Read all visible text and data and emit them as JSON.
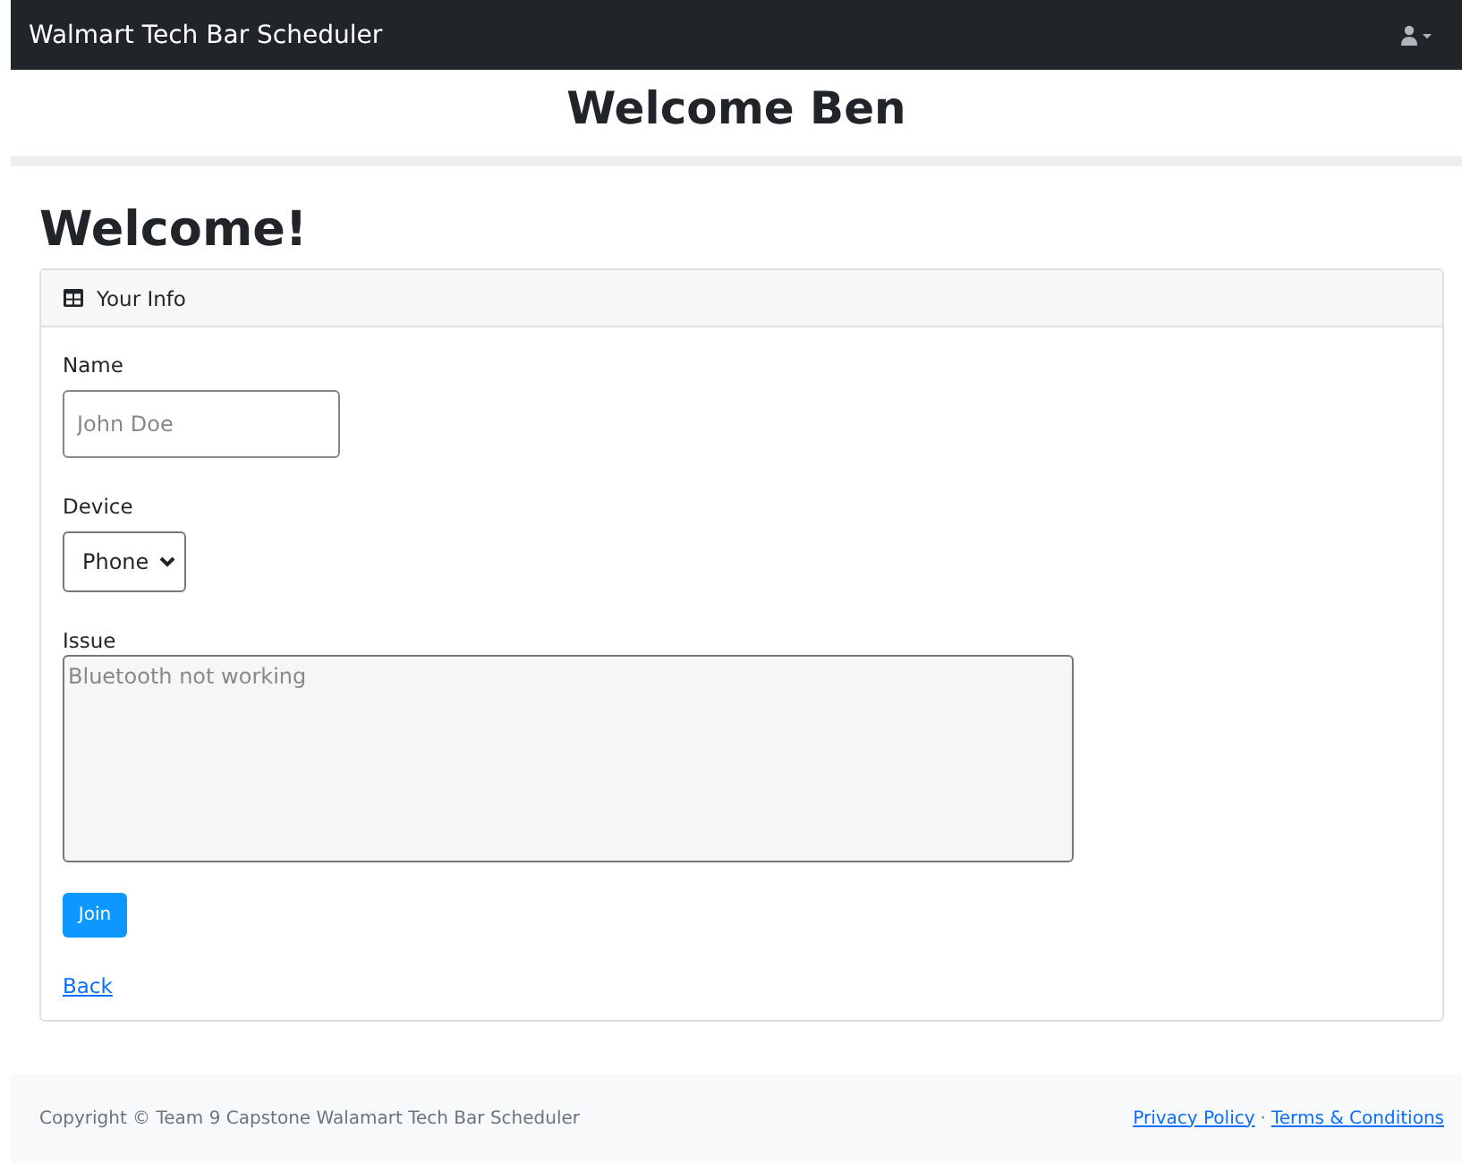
{
  "navbar": {
    "brand": "Walmart Tech Bar Scheduler"
  },
  "banner": {
    "title": "Welcome Ben"
  },
  "page": {
    "heading": "Welcome!"
  },
  "card": {
    "header": "Your Info",
    "name_field": {
      "label": "Name",
      "placeholder": "John Doe"
    },
    "device_field": {
      "label": "Device",
      "value": "Phone"
    },
    "issue_field": {
      "label": "Issue",
      "placeholder": "Bluetooth not working"
    },
    "submit_button": "Join",
    "back_link": "Back"
  },
  "footer": {
    "copyright": "Copyright © Team 9 Capstone Walamart Tech Bar Scheduler",
    "links": [
      "Privacy Policy",
      "Terms & Conditions"
    ],
    "separator": "·"
  }
}
